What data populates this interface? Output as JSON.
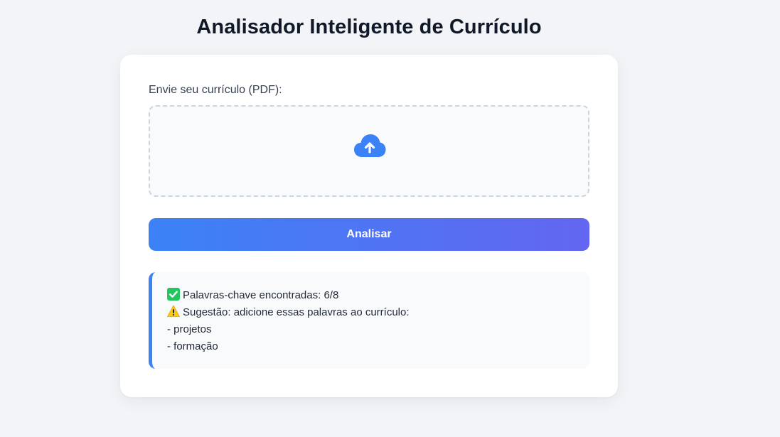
{
  "page": {
    "title": "Analisador Inteligente de Currículo"
  },
  "upload": {
    "label": "Envie seu currículo (PDF):",
    "icon": "cloud-upload-icon"
  },
  "analyze_button": {
    "label": "Analisar"
  },
  "result": {
    "keywords_found": {
      "icon": "check-mark-icon",
      "text": "Palavras-chave encontradas: 6/8"
    },
    "suggestion": {
      "icon": "warning-icon",
      "text": "Sugestão: adicione essas palavras ao currículo:"
    },
    "missing_keywords": [
      "- projetos",
      "- formação"
    ]
  },
  "colors": {
    "background": "#f2f4f7",
    "card": "#ffffff",
    "accent": "#3b82f6",
    "accent_end": "#6366f1",
    "check": "#22c55e",
    "warning": "#facc15"
  }
}
